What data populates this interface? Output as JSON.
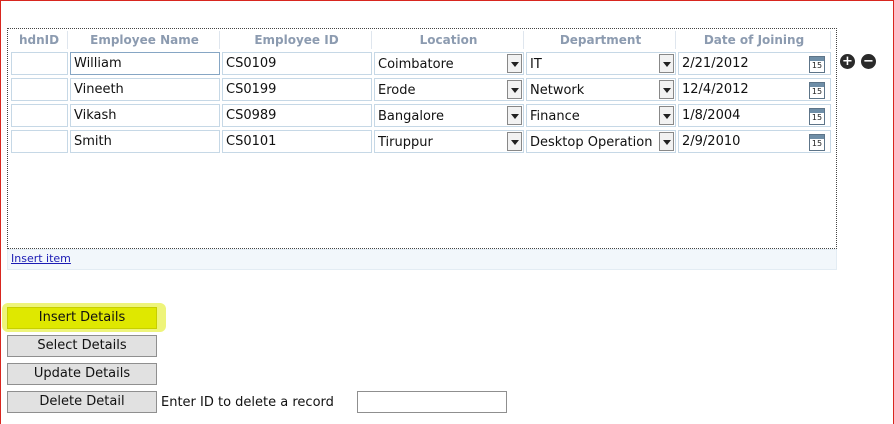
{
  "grid": {
    "headers": [
      "hdnID",
      "Employee Name",
      "Employee ID",
      "Location",
      "Department",
      "Date of Joining"
    ],
    "rows": [
      {
        "hdnid": "",
        "name": "William",
        "emp_id": "CS0109",
        "location": "Coimbatore",
        "department": "IT",
        "doj": "2/21/2012"
      },
      {
        "hdnid": "",
        "name": "Vineeth",
        "emp_id": "CS0199",
        "location": "Erode",
        "department": "Network",
        "doj": "12/4/2012"
      },
      {
        "hdnid": "",
        "name": "Vikash",
        "emp_id": "CS0989",
        "location": "Bangalore",
        "department": "Finance",
        "doj": "1/8/2004"
      },
      {
        "hdnid": "",
        "name": "Smith",
        "emp_id": "CS0101",
        "location": "Tiruppur",
        "department": "Desktop Operation",
        "doj": "2/9/2010"
      }
    ],
    "calendar_day": "15",
    "insert_item_link": "Insert item",
    "add_icon": "+",
    "remove_icon": "−"
  },
  "buttons": {
    "insert": "Insert Details",
    "select": "Select Details",
    "update": "Update Details",
    "delete": "Delete Detail"
  },
  "delete_prompt": "Enter ID to delete a record",
  "delete_input_value": "",
  "highlight_color": "#dfe800"
}
